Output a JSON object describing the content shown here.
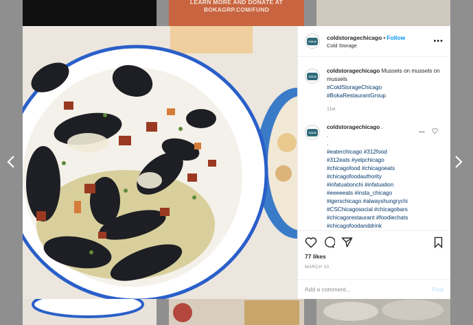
{
  "background": {
    "top_banner_line1": "LEARN MORE AND DONATE AT",
    "top_banner_line2": "BOKAGRP.COM/FUND"
  },
  "nav": {
    "prev_icon": "chevron-left-icon",
    "next_icon": "chevron-right-icon"
  },
  "post": {
    "username": "coldstoragechicago",
    "follow_label": "Follow",
    "location": "Cold Storage",
    "caption": {
      "username": "coldstoragechicago",
      "text": "Mussels on mussels on mussels",
      "tags": [
        "#ColdStorageChicago",
        "#BokaRestaurantGroup"
      ],
      "time": "11w"
    },
    "comment": {
      "username": "coldstoragechicago",
      "text_tail": " .",
      "dots": [
        ".",
        "."
      ],
      "tag_lines": [
        "#eaterchicago #312food",
        "#312eats #yelpchicago",
        "#chicagofood #chicagoeats",
        "#chicagofoodauthority",
        "#infatuationchi #infatuation",
        "#eeeeeats #insta_chicago",
        "#igerschicago #alwayshungrychi",
        "#CSChicagosocial #chicagobars",
        "#chicagorestaurant #foodiechats",
        "#chicagofoodanddrink"
      ]
    },
    "likes": "77 likes",
    "date": "MARCH 10",
    "comment_placeholder": "Add a comment...",
    "post_label": "Post"
  },
  "colors": {
    "link": "#0095f6",
    "hashtag": "#00376b",
    "bowl_rim": "#2a5fc9"
  }
}
